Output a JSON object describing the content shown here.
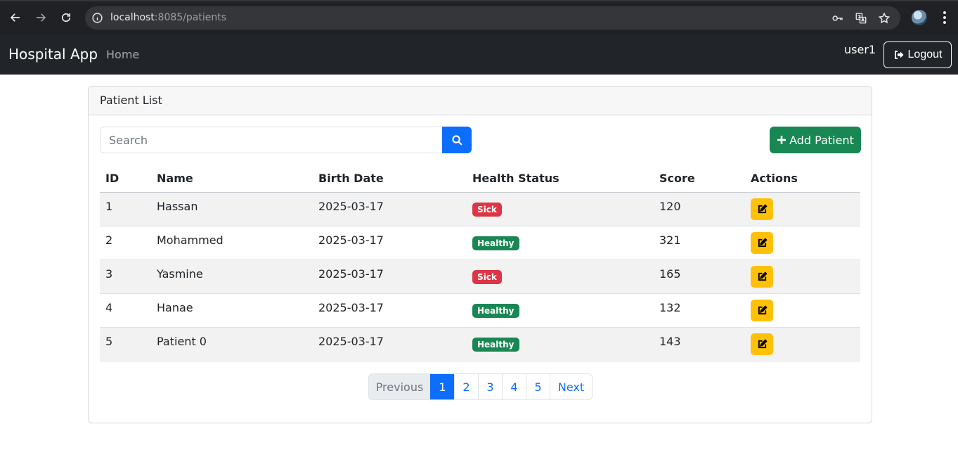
{
  "browser": {
    "url_host": "localhost",
    "url_path": ":8085/patients"
  },
  "navbar": {
    "brand": "Hospital App",
    "home_label": "Home",
    "username": "user1",
    "logout_label": "Logout"
  },
  "card": {
    "title": "Patient List",
    "search_placeholder": "Search",
    "add_label": "Add Patient"
  },
  "table": {
    "headers": [
      "ID",
      "Name",
      "Birth Date",
      "Health Status",
      "Score",
      "Actions"
    ],
    "rows": [
      {
        "id": "1",
        "name": "Hassan",
        "birth_date": "2025-03-17",
        "status": "Sick",
        "score": "120"
      },
      {
        "id": "2",
        "name": "Mohammed",
        "birth_date": "2025-03-17",
        "status": "Healthy",
        "score": "321"
      },
      {
        "id": "3",
        "name": "Yasmine",
        "birth_date": "2025-03-17",
        "status": "Sick",
        "score": "165"
      },
      {
        "id": "4",
        "name": "Hanae",
        "birth_date": "2025-03-17",
        "status": "Healthy",
        "score": "132"
      },
      {
        "id": "5",
        "name": "Patient 0",
        "birth_date": "2025-03-17",
        "status": "Healthy",
        "score": "143"
      }
    ]
  },
  "pagination": {
    "previous": "Previous",
    "pages": [
      "1",
      "2",
      "3",
      "4",
      "5"
    ],
    "active_page": "1",
    "next": "Next"
  },
  "colors": {
    "sick": "#dc3545",
    "healthy": "#198754",
    "primary": "#0d6efd",
    "warning": "#ffc107"
  },
  "icons": {
    "back": "arrow-left-icon",
    "forward": "arrow-right-icon",
    "reload": "reload-icon",
    "site_info": "site-info-icon",
    "password": "key-icon",
    "translate": "translate-icon",
    "bookmark": "star-icon",
    "logout": "sign-out-icon",
    "search": "search-icon",
    "add": "plus-icon",
    "edit": "edit-icon"
  }
}
